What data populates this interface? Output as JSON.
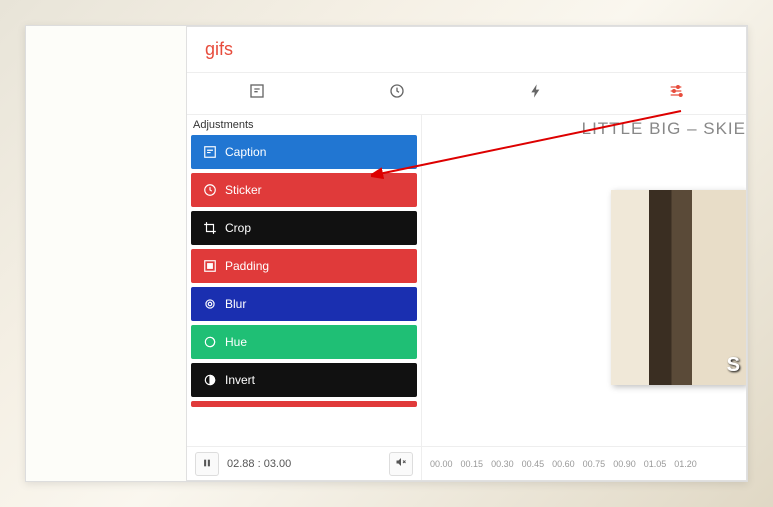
{
  "brand": "gifs",
  "sidebar": {
    "section_label": "Adjustments",
    "items": [
      {
        "label": "Caption",
        "color": "c-blue",
        "icon": "caption"
      },
      {
        "label": "Sticker",
        "color": "c-red",
        "icon": "sticker"
      },
      {
        "label": "Crop",
        "color": "c-black",
        "icon": "crop"
      },
      {
        "label": "Padding",
        "color": "c-red",
        "icon": "padding"
      },
      {
        "label": "Blur",
        "color": "c-indigo",
        "icon": "blur"
      },
      {
        "label": "Hue",
        "color": "c-green",
        "icon": "hue"
      },
      {
        "label": "Invert",
        "color": "c-black",
        "icon": "invert"
      }
    ]
  },
  "preview": {
    "title": "LITTLE BIG – SKIE"
  },
  "controls": {
    "time": "02.88 : 03.00",
    "ticks": [
      "00.00",
      "00.15",
      "00.30",
      "00.45",
      "00.60",
      "00.75",
      "00.90",
      "01.05",
      "01.20"
    ]
  }
}
